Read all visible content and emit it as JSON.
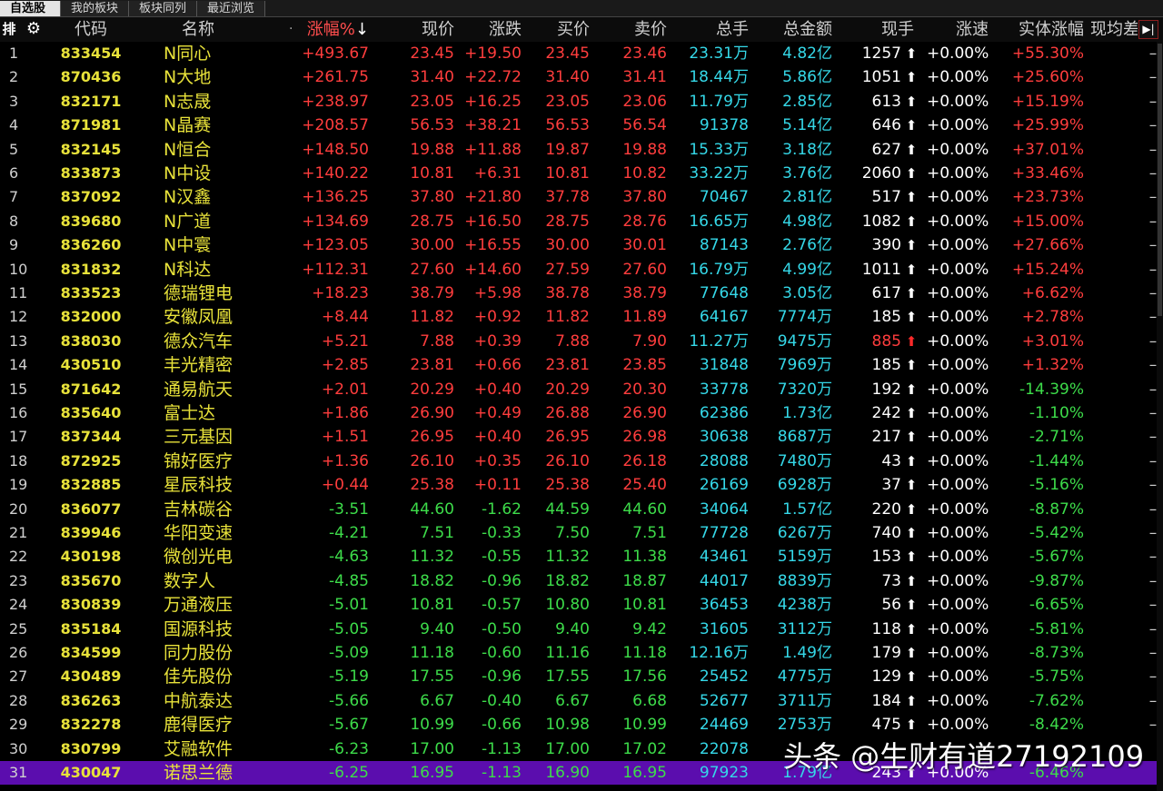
{
  "tabs": [
    "自选股",
    "我的板块",
    "板块同列",
    "最近浏览"
  ],
  "header": {
    "sort_icon": "排",
    "code": "代码",
    "name": "名称",
    "dot": "·",
    "change_pct": "涨幅%",
    "sort_arrow": "↓",
    "price": "现价",
    "change": "涨跌",
    "bid": "买价",
    "ask": "卖价",
    "volume": "总手",
    "amount": "总金额",
    "current_vol": "现手",
    "speed": "涨速",
    "body_change": "实体涨幅",
    "avg_diff": "现均差",
    "end_icon": "▶|"
  },
  "colors": {
    "up": "#ff3d3d",
    "down": "#3ddc4a",
    "code": "#e8e23a",
    "volume": "#35d8e8",
    "selected": "#5b0dae"
  },
  "rows": [
    {
      "no": "1",
      "code": "833454",
      "name": "N同心",
      "chg": "+493.67",
      "price": "23.45",
      "diff": "+19.50",
      "bid": "23.45",
      "ask": "23.46",
      "vol": "23.31万",
      "amt": "4.82亿",
      "cur": "1257",
      "arrow": "up-white",
      "spd": "+0.00%",
      "body": "+55.30%",
      "avg": "–",
      "dir": "up"
    },
    {
      "no": "2",
      "code": "870436",
      "name": "N大地",
      "chg": "+261.75",
      "price": "31.40",
      "diff": "+22.72",
      "bid": "31.40",
      "ask": "31.41",
      "vol": "18.44万",
      "amt": "5.86亿",
      "cur": "1051",
      "arrow": "up-white",
      "spd": "+0.00%",
      "body": "+25.60%",
      "avg": "–",
      "dir": "up"
    },
    {
      "no": "3",
      "code": "832171",
      "name": "N志晟",
      "chg": "+238.97",
      "price": "23.05",
      "diff": "+16.25",
      "bid": "23.05",
      "ask": "23.06",
      "vol": "11.79万",
      "amt": "2.85亿",
      "cur": "613",
      "arrow": "up-white",
      "spd": "+0.00%",
      "body": "+15.19%",
      "avg": "–",
      "dir": "up"
    },
    {
      "no": "4",
      "code": "871981",
      "name": "N晶赛",
      "chg": "+208.57",
      "price": "56.53",
      "diff": "+38.21",
      "bid": "56.53",
      "ask": "56.54",
      "vol": "91378",
      "amt": "5.14亿",
      "cur": "646",
      "arrow": "up-white",
      "spd": "+0.00%",
      "body": "+25.99%",
      "avg": "–",
      "dir": "up"
    },
    {
      "no": "5",
      "code": "832145",
      "name": "N恒合",
      "chg": "+148.50",
      "price": "19.88",
      "diff": "+11.88",
      "bid": "19.87",
      "ask": "19.88",
      "vol": "15.33万",
      "amt": "3.18亿",
      "cur": "627",
      "arrow": "up-white",
      "spd": "+0.00%",
      "body": "+37.01%",
      "avg": "–",
      "dir": "up"
    },
    {
      "no": "6",
      "code": "833873",
      "name": "N中设",
      "chg": "+140.22",
      "price": "10.81",
      "diff": "+6.31",
      "bid": "10.81",
      "ask": "10.82",
      "vol": "33.22万",
      "amt": "3.76亿",
      "cur": "2060",
      "arrow": "up-white",
      "spd": "+0.00%",
      "body": "+33.46%",
      "avg": "–",
      "dir": "up"
    },
    {
      "no": "7",
      "code": "837092",
      "name": "N汉鑫",
      "chg": "+136.25",
      "price": "37.80",
      "diff": "+21.80",
      "bid": "37.78",
      "ask": "37.80",
      "vol": "70467",
      "amt": "2.81亿",
      "cur": "517",
      "arrow": "up-white",
      "spd": "+0.00%",
      "body": "+23.73%",
      "avg": "–",
      "dir": "up"
    },
    {
      "no": "8",
      "code": "839680",
      "name": "N广道",
      "chg": "+134.69",
      "price": "28.75",
      "diff": "+16.50",
      "bid": "28.75",
      "ask": "28.76",
      "vol": "16.65万",
      "amt": "4.98亿",
      "cur": "1082",
      "arrow": "up-white",
      "spd": "+0.00%",
      "body": "+15.00%",
      "avg": "–",
      "dir": "up"
    },
    {
      "no": "9",
      "code": "836260",
      "name": "N中寰",
      "chg": "+123.05",
      "price": "30.00",
      "diff": "+16.55",
      "bid": "30.00",
      "ask": "30.01",
      "vol": "87143",
      "amt": "2.76亿",
      "cur": "390",
      "arrow": "up-white",
      "spd": "+0.00%",
      "body": "+27.66%",
      "avg": "–",
      "dir": "up"
    },
    {
      "no": "10",
      "code": "831832",
      "name": "N科达",
      "chg": "+112.31",
      "price": "27.60",
      "diff": "+14.60",
      "bid": "27.59",
      "ask": "27.60",
      "vol": "16.79万",
      "amt": "4.99亿",
      "cur": "1011",
      "arrow": "up-white",
      "spd": "+0.00%",
      "body": "+15.24%",
      "avg": "–",
      "dir": "up"
    },
    {
      "no": "11",
      "code": "833523",
      "name": "德瑞锂电",
      "chg": "+18.23",
      "price": "38.79",
      "diff": "+5.98",
      "bid": "38.78",
      "ask": "38.79",
      "vol": "77648",
      "amt": "3.05亿",
      "cur": "617",
      "arrow": "up-white",
      "spd": "+0.00%",
      "body": "+6.62%",
      "avg": "–",
      "dir": "up"
    },
    {
      "no": "12",
      "code": "832000",
      "name": "安徽凤凰",
      "chg": "+8.44",
      "price": "11.82",
      "diff": "+0.92",
      "bid": "11.82",
      "ask": "11.89",
      "vol": "64167",
      "amt": "7774万",
      "cur": "185",
      "arrow": "up-white",
      "spd": "+0.00%",
      "body": "+2.78%",
      "avg": "–",
      "dir": "up"
    },
    {
      "no": "13",
      "code": "838030",
      "name": "德众汽车",
      "chg": "+5.21",
      "price": "7.88",
      "diff": "+0.39",
      "bid": "7.88",
      "ask": "7.90",
      "vol": "11.27万",
      "amt": "9475万",
      "cur": "885",
      "arrow": "up-red",
      "spd": "+0.00%",
      "body": "+3.01%",
      "avg": "–",
      "dir": "up",
      "cur_red": true
    },
    {
      "no": "14",
      "code": "430510",
      "name": "丰光精密",
      "chg": "+2.85",
      "price": "23.81",
      "diff": "+0.66",
      "bid": "23.81",
      "ask": "23.85",
      "vol": "31848",
      "amt": "7969万",
      "cur": "185",
      "arrow": "up-white",
      "spd": "+0.00%",
      "body": "+1.32%",
      "avg": "–",
      "dir": "up"
    },
    {
      "no": "15",
      "code": "871642",
      "name": "通易航天",
      "chg": "+2.01",
      "price": "20.29",
      "diff": "+0.40",
      "bid": "20.29",
      "ask": "20.30",
      "vol": "33778",
      "amt": "7320万",
      "cur": "192",
      "arrow": "up-white",
      "spd": "+0.00%",
      "body": "-14.39%",
      "avg": "–",
      "dir": "up",
      "body_dir": "down"
    },
    {
      "no": "16",
      "code": "835640",
      "name": "富士达",
      "chg": "+1.86",
      "price": "26.90",
      "diff": "+0.49",
      "bid": "26.88",
      "ask": "26.90",
      "vol": "62386",
      "amt": "1.73亿",
      "cur": "242",
      "arrow": "up-white",
      "spd": "+0.00%",
      "body": "-1.10%",
      "avg": "–",
      "dir": "up",
      "body_dir": "down"
    },
    {
      "no": "17",
      "code": "837344",
      "name": "三元基因",
      "chg": "+1.51",
      "price": "26.95",
      "diff": "+0.40",
      "bid": "26.95",
      "ask": "26.98",
      "vol": "30638",
      "amt": "8687万",
      "cur": "217",
      "arrow": "up-white",
      "spd": "+0.00%",
      "body": "-2.71%",
      "avg": "–",
      "dir": "up",
      "body_dir": "down"
    },
    {
      "no": "18",
      "code": "872925",
      "name": "锦好医疗",
      "chg": "+1.36",
      "price": "26.10",
      "diff": "+0.35",
      "bid": "26.10",
      "ask": "26.18",
      "vol": "28088",
      "amt": "7480万",
      "cur": "43",
      "arrow": "up-white",
      "spd": "+0.00%",
      "body": "-1.44%",
      "avg": "–",
      "dir": "up",
      "body_dir": "down"
    },
    {
      "no": "19",
      "code": "832885",
      "name": "星辰科技",
      "chg": "+0.44",
      "price": "25.38",
      "diff": "+0.11",
      "bid": "25.38",
      "ask": "25.40",
      "vol": "26169",
      "amt": "6928万",
      "cur": "37",
      "arrow": "up-white",
      "spd": "+0.00%",
      "body": "-5.16%",
      "avg": "–",
      "dir": "up",
      "body_dir": "down"
    },
    {
      "no": "20",
      "code": "836077",
      "name": "吉林碳谷",
      "chg": "-3.51",
      "price": "44.60",
      "diff": "-1.62",
      "bid": "44.59",
      "ask": "44.60",
      "vol": "34064",
      "amt": "1.57亿",
      "cur": "220",
      "arrow": "up-white",
      "spd": "+0.00%",
      "body": "-8.87%",
      "avg": "–",
      "dir": "down"
    },
    {
      "no": "21",
      "code": "839946",
      "name": "华阳变速",
      "chg": "-4.21",
      "price": "7.51",
      "diff": "-0.33",
      "bid": "7.50",
      "ask": "7.51",
      "vol": "77728",
      "amt": "6267万",
      "cur": "740",
      "arrow": "up-white",
      "spd": "+0.00%",
      "body": "-5.42%",
      "avg": "–",
      "dir": "down"
    },
    {
      "no": "22",
      "code": "430198",
      "name": "微创光电",
      "chg": "-4.63",
      "price": "11.32",
      "diff": "-0.55",
      "bid": "11.32",
      "ask": "11.38",
      "vol": "43461",
      "amt": "5159万",
      "cur": "153",
      "arrow": "up-white",
      "spd": "+0.00%",
      "body": "-5.67%",
      "avg": "–",
      "dir": "down"
    },
    {
      "no": "23",
      "code": "835670",
      "name": "数字人",
      "chg": "-4.85",
      "price": "18.82",
      "diff": "-0.96",
      "bid": "18.82",
      "ask": "18.87",
      "vol": "44017",
      "amt": "8839万",
      "cur": "73",
      "arrow": "up-white",
      "spd": "+0.00%",
      "body": "-9.87%",
      "avg": "–",
      "dir": "down"
    },
    {
      "no": "24",
      "code": "830839",
      "name": "万通液压",
      "chg": "-5.01",
      "price": "10.81",
      "diff": "-0.57",
      "bid": "10.80",
      "ask": "10.81",
      "vol": "36453",
      "amt": "4238万",
      "cur": "56",
      "arrow": "up-white",
      "spd": "+0.00%",
      "body": "-6.65%",
      "avg": "–",
      "dir": "down"
    },
    {
      "no": "25",
      "code": "835184",
      "name": "国源科技",
      "chg": "-5.05",
      "price": "9.40",
      "diff": "-0.50",
      "bid": "9.40",
      "ask": "9.42",
      "vol": "31605",
      "amt": "3112万",
      "cur": "118",
      "arrow": "up-white",
      "spd": "+0.00%",
      "body": "-5.81%",
      "avg": "–",
      "dir": "down"
    },
    {
      "no": "26",
      "code": "834599",
      "name": "同力股份",
      "chg": "-5.09",
      "price": "11.18",
      "diff": "-0.60",
      "bid": "11.16",
      "ask": "11.18",
      "vol": "12.16万",
      "amt": "1.49亿",
      "cur": "179",
      "arrow": "up-white",
      "spd": "+0.00%",
      "body": "-8.73%",
      "avg": "–",
      "dir": "down"
    },
    {
      "no": "27",
      "code": "430489",
      "name": "佳先股份",
      "chg": "-5.19",
      "price": "17.55",
      "diff": "-0.96",
      "bid": "17.55",
      "ask": "17.56",
      "vol": "25452",
      "amt": "4775万",
      "cur": "129",
      "arrow": "up-white",
      "spd": "+0.00%",
      "body": "-5.75%",
      "avg": "–",
      "dir": "down"
    },
    {
      "no": "28",
      "code": "836263",
      "name": "中航泰达",
      "chg": "-5.66",
      "price": "6.67",
      "diff": "-0.40",
      "bid": "6.67",
      "ask": "6.68",
      "vol": "52677",
      "amt": "3711万",
      "cur": "184",
      "arrow": "up-white",
      "spd": "+0.00%",
      "body": "-7.62%",
      "avg": "–",
      "dir": "down"
    },
    {
      "no": "29",
      "code": "832278",
      "name": "鹿得医疗",
      "chg": "-5.67",
      "price": "10.99",
      "diff": "-0.66",
      "bid": "10.98",
      "ask": "10.99",
      "vol": "24469",
      "amt": "2753万",
      "cur": "475",
      "arrow": "up-white",
      "spd": "+0.00%",
      "body": "-8.42%",
      "avg": "–",
      "dir": "down"
    },
    {
      "no": "30",
      "code": "830799",
      "name": "艾融软件",
      "chg": "-6.23",
      "price": "17.00",
      "diff": "-1.13",
      "bid": "17.00",
      "ask": "17.02",
      "vol": "22078",
      "amt": "",
      "cur": "",
      "arrow": "none",
      "spd": "",
      "body": "",
      "avg": "",
      "dir": "down"
    },
    {
      "no": "31",
      "code": "430047",
      "name": "诺思兰德",
      "chg": "-6.25",
      "price": "16.95",
      "diff": "-1.13",
      "bid": "16.90",
      "ask": "16.95",
      "vol": "97923",
      "amt": "1.79亿",
      "cur": "243",
      "arrow": "up-white",
      "spd": "+0.00%",
      "body": "-6.46%",
      "avg": "",
      "dir": "down",
      "selected": true
    }
  ],
  "watermark": "头条 @生财有道27192109"
}
